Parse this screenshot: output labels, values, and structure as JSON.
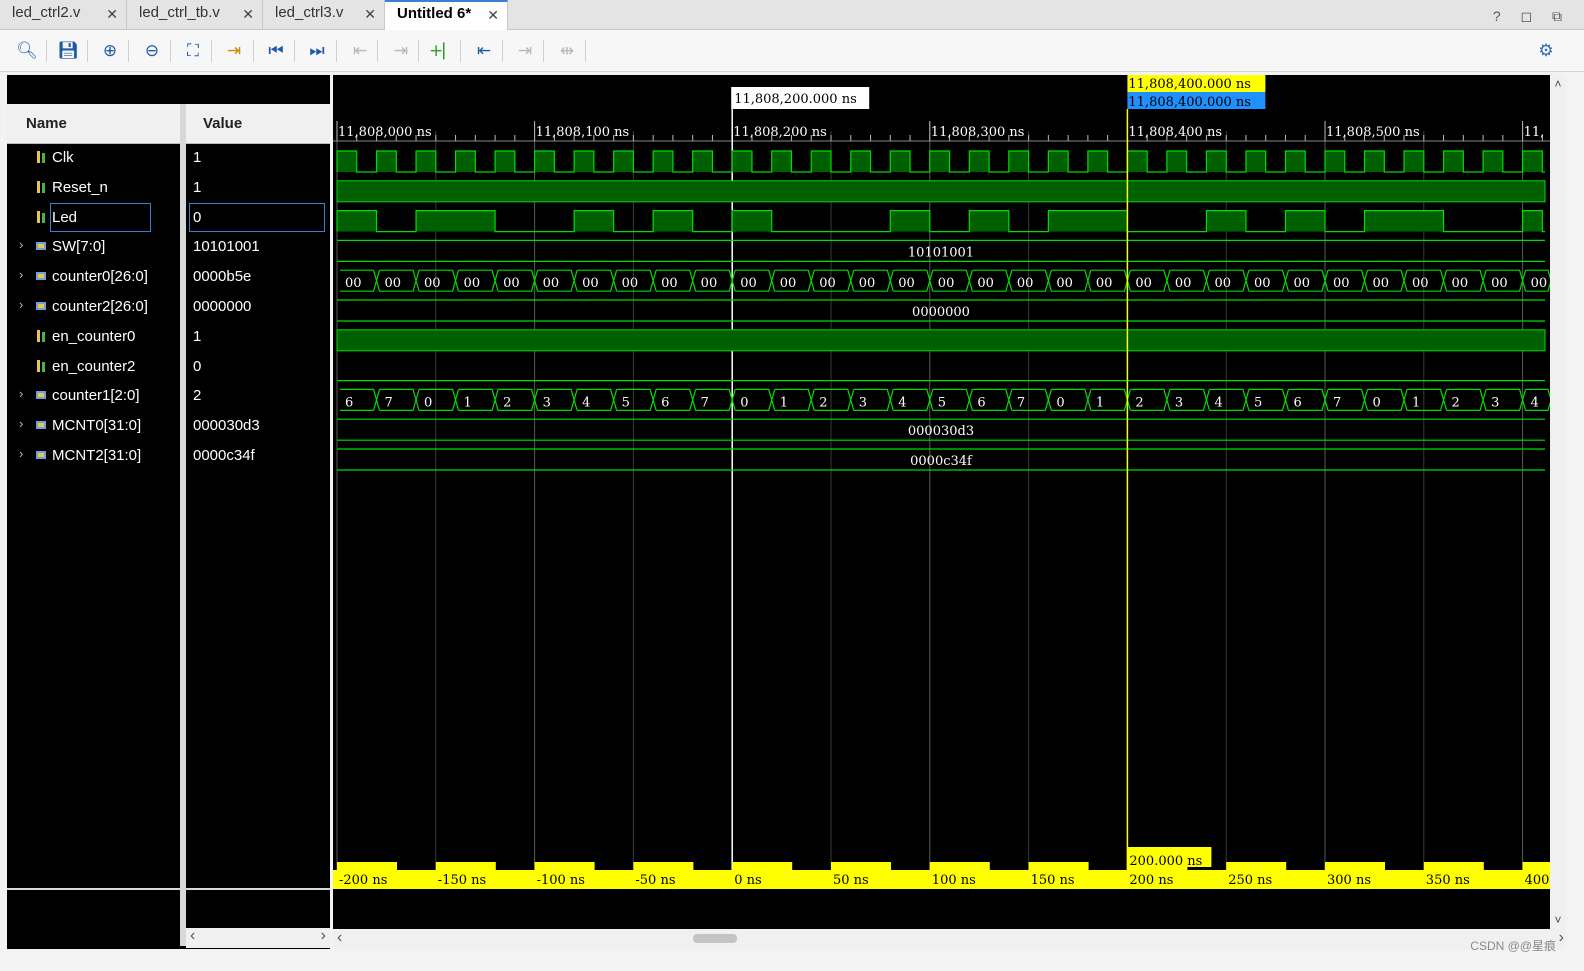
{
  "tabs": [
    {
      "label": "led_ctrl2.v",
      "active": false
    },
    {
      "label": "led_ctrl_tb.v",
      "active": false
    },
    {
      "label": "led_ctrl3.v",
      "active": false
    },
    {
      "label": "Untitled 6*",
      "active": true
    }
  ],
  "window_controls": "? ◻ ⧉",
  "toolbar": [
    {
      "name": "search-icon",
      "glyph": "🔍︎",
      "enabled": true
    },
    {
      "name": "save-icon",
      "glyph": "💾︎",
      "enabled": true
    },
    {
      "name": "zoom-in-icon",
      "glyph": "⊕",
      "enabled": true
    },
    {
      "name": "zoom-out-icon",
      "glyph": "⊖",
      "enabled": true
    },
    {
      "name": "zoom-fit-icon",
      "glyph": "⛶",
      "enabled": true
    },
    {
      "name": "go-to-cursor-icon",
      "glyph": "⇥",
      "enabled": true
    },
    {
      "name": "go-to-time-0-icon",
      "glyph": "⏮",
      "enabled": true
    },
    {
      "name": "go-to-last-time-icon",
      "glyph": "⏭",
      "enabled": true
    },
    {
      "name": "previous-transition-icon",
      "glyph": "⇤",
      "enabled": false
    },
    {
      "name": "next-transition-icon",
      "glyph": "⇥",
      "enabled": false
    },
    {
      "name": "add-marker-icon",
      "glyph": "+⎸",
      "enabled": true
    },
    {
      "name": "previous-marker-icon",
      "glyph": "⇤",
      "enabled": true
    },
    {
      "name": "next-marker-icon",
      "glyph": "⇥",
      "enabled": false
    },
    {
      "name": "swap-cursors-icon",
      "glyph": "⇹",
      "enabled": false
    }
  ],
  "settings_icon": "⚙",
  "columns": {
    "name": "Name",
    "value": "Value"
  },
  "signals": [
    {
      "name": "Clk",
      "value": "1",
      "kind": "bit",
      "expandable": false
    },
    {
      "name": "Reset_n",
      "value": "1",
      "kind": "bit",
      "expandable": false
    },
    {
      "name": "Led",
      "value": "0",
      "kind": "bit",
      "expandable": false,
      "selected": true
    },
    {
      "name": "SW[7:0]",
      "value": "10101001",
      "kind": "bus",
      "expandable": true
    },
    {
      "name": "counter0[26:0]",
      "value": "0000b5e",
      "kind": "bus",
      "expandable": true
    },
    {
      "name": "counter2[26:0]",
      "value": "0000000",
      "kind": "bus",
      "expandable": true
    },
    {
      "name": "en_counter0",
      "value": "1",
      "kind": "bit",
      "expandable": false
    },
    {
      "name": "en_counter2",
      "value": "0",
      "kind": "bit",
      "expandable": false
    },
    {
      "name": "counter1[2:0]",
      "value": "2",
      "kind": "bus",
      "expandable": true
    },
    {
      "name": "MCNT0[31:0]",
      "value": "000030d3",
      "kind": "bus",
      "expandable": true
    },
    {
      "name": "MCNT2[31:0]",
      "value": "0000c34f",
      "kind": "bus",
      "expandable": true
    }
  ],
  "timeline": {
    "ticks": [
      "11,808,000 ns",
      "11,808,100 ns",
      "11,808,200 ns",
      "11,808,300 ns",
      "11,808,400 ns",
      "11,808,500 ns",
      "11,"
    ],
    "marker_label": "11,808,200.000 ns",
    "cursor_label_top": "11,808,400.000 ns",
    "cursor_label_bottom": "11,808,400.000 ns",
    "delta_label": "200.000 ns",
    "bottom_ticks": [
      "-200 ns",
      "-150 ns",
      "-100 ns",
      "-50 ns",
      "0 ns",
      "50 ns",
      "100 ns",
      "150 ns",
      "200 ns",
      "250 ns",
      "300 ns",
      "350 ns",
      "400"
    ]
  },
  "waves": {
    "clk_edges_per_half_ns": 10,
    "led_high_ranges_ns": [
      [
        11807999,
        11808020
      ],
      [
        11808040,
        11808080
      ],
      [
        11808120,
        11808140
      ],
      [
        11808160,
        11808180
      ],
      [
        11808200,
        11808220
      ],
      [
        11808280,
        11808300
      ],
      [
        11808320,
        11808340
      ],
      [
        11808360,
        11808400
      ],
      [
        11808440,
        11808460
      ],
      [
        11808480,
        11808500
      ],
      [
        11808520,
        11808560
      ],
      [
        11808600,
        11808610
      ]
    ],
    "sw_label": "10101001",
    "counter0_label": "00",
    "counter2_label": "0000000",
    "counter1_sequence": [
      "6",
      "7",
      "0",
      "1",
      "2",
      "3",
      "4",
      "5",
      "6",
      "7",
      "0",
      "1",
      "2",
      "3",
      "4",
      "5",
      "6",
      "7",
      "0",
      "1",
      "2",
      "3",
      "4",
      "5",
      "6",
      "7",
      "0",
      "1",
      "2",
      "3",
      "4"
    ],
    "mcnt0_label": "000030d3",
    "mcnt2_label": "0000c34f"
  },
  "colors": {
    "wave": "#00dd00",
    "wave_fill": "#005f00",
    "cursor": "#ffff00",
    "marker_bg": "#ffffff",
    "accent": "#1e90ff"
  },
  "scroll": {
    "left": "‹",
    "right": "›",
    "up": "˄",
    "down": "˅"
  },
  "watermark": "CSDN @@星痕"
}
